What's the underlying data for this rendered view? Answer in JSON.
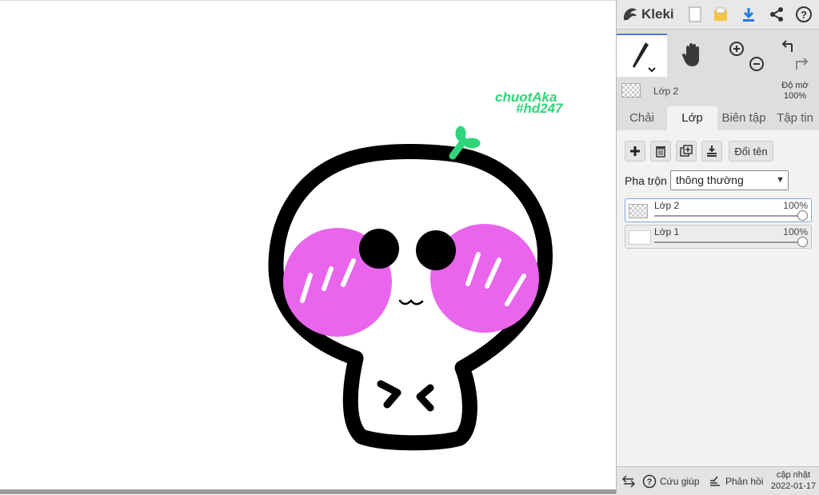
{
  "canvas": {
    "watermark_line1": "chuotAka",
    "watermark_line2": "#hd247",
    "colors": {
      "outline": "#000000",
      "blush": "#e865ec",
      "sprout": "#2fd57a",
      "watermark": "#2fd57a"
    }
  },
  "app": {
    "name": "Kleki",
    "toolbar_icons": [
      "kleki-logo-icon",
      "new-file-icon",
      "open-file-icon",
      "download-icon",
      "share-icon",
      "help-icon"
    ]
  },
  "tools": {
    "items": [
      "brush-tool-icon",
      "hand-tool-icon",
      "zoom-in-icon",
      "zoom-out-icon",
      "undo-icon",
      "redo-icon"
    ],
    "active": "brush"
  },
  "layer_info": {
    "name": "Lớp 2",
    "opacity_label": "Độ mờ",
    "opacity_value": "100%"
  },
  "tabs": [
    {
      "label": "Chải",
      "active": false
    },
    {
      "label": "Lớp",
      "active": true
    },
    {
      "label": "Biên tập",
      "active": false
    },
    {
      "label": "Tập tin",
      "active": false
    }
  ],
  "layer_panel": {
    "rename_label": "Đổi tên",
    "blend_label": "Pha trộn",
    "blend_value": "thông thường",
    "layers": [
      {
        "name": "Lớp 2",
        "opacity": "100%",
        "selected": true
      },
      {
        "name": "Lớp 1",
        "opacity": "100%",
        "selected": false
      }
    ]
  },
  "footer": {
    "help_label": "Cứu giúp",
    "feedback_label": "Phản hồi",
    "update_label": "cập nhật",
    "update_date": "2022-01-17"
  }
}
